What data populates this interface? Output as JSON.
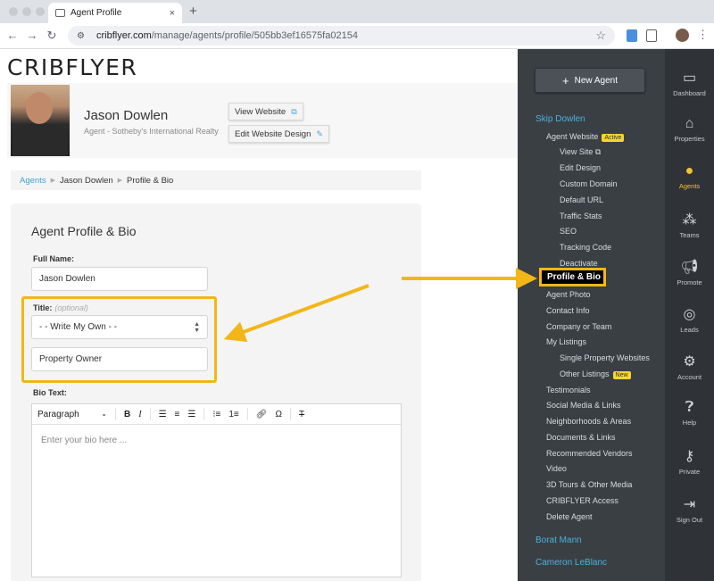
{
  "browser": {
    "tab_title": "Agent Profile",
    "new_tab": "+",
    "close": "×",
    "url_host": "cribflyer.com",
    "url_path": "/manage/agents/profile/505bb3ef16575fa02154"
  },
  "brand": {
    "logo": "CRIBFLYER"
  },
  "hero": {
    "name": "Jason Dowlen",
    "subtitle": "Agent - Sotheby's International Realty",
    "view_website": "View Website",
    "edit_website": "Edit Website Design"
  },
  "breadcrumb": {
    "items": [
      "Agents",
      "Jason Dowlen",
      "Profile & Bio"
    ]
  },
  "form": {
    "title": "Agent Profile & Bio",
    "full_name_label": "Full Name:",
    "full_name_value": "Jason Dowlen",
    "title_label": "Title:",
    "title_optional": "(optional)",
    "title_select": "- - Write My Own - -",
    "title_custom": "Property Owner",
    "bio_label": "Bio Text:",
    "bio_placeholder": "Enter your bio here ...",
    "editor_format": "Paragraph"
  },
  "sidebar": {
    "new_agent": "New Agent",
    "agent1": "Skip Dowlen",
    "agent_website": "Agent Website",
    "active_badge": "Active",
    "sub": [
      "View Site",
      "Edit Design",
      "Custom Domain",
      "Default URL",
      "Traffic Stats",
      "SEO",
      "Tracking Code",
      "Deactivate"
    ],
    "profile_bio": "Profile & Bio",
    "items": [
      "Agent Photo",
      "Contact Info",
      "Company or Team",
      "My Listings"
    ],
    "listings_sub": [
      "Single Property Websites",
      "Other Listings"
    ],
    "new_badge": "New",
    "items2": [
      "Testimonials",
      "Social Media & Links",
      "Neighborhoods & Areas",
      "Documents & Links",
      "Recommended Vendors",
      "Video",
      "3D Tours & Other Media",
      "CRIBFLYER Access",
      "Delete Agent"
    ],
    "agent2": "Borat Mann",
    "agent3": "Cameron LeBlanc"
  },
  "rail": {
    "items": [
      "Dashboard",
      "Properties",
      "Agents",
      "Teams",
      "Promote",
      "Leads",
      "Account",
      "Help",
      "Private",
      "Sign Out"
    ]
  },
  "colors": {
    "accent": "#4ab3dc",
    "highlight": "#f2b619",
    "sidebar": "#3a3f44",
    "rail": "#2f3337"
  }
}
